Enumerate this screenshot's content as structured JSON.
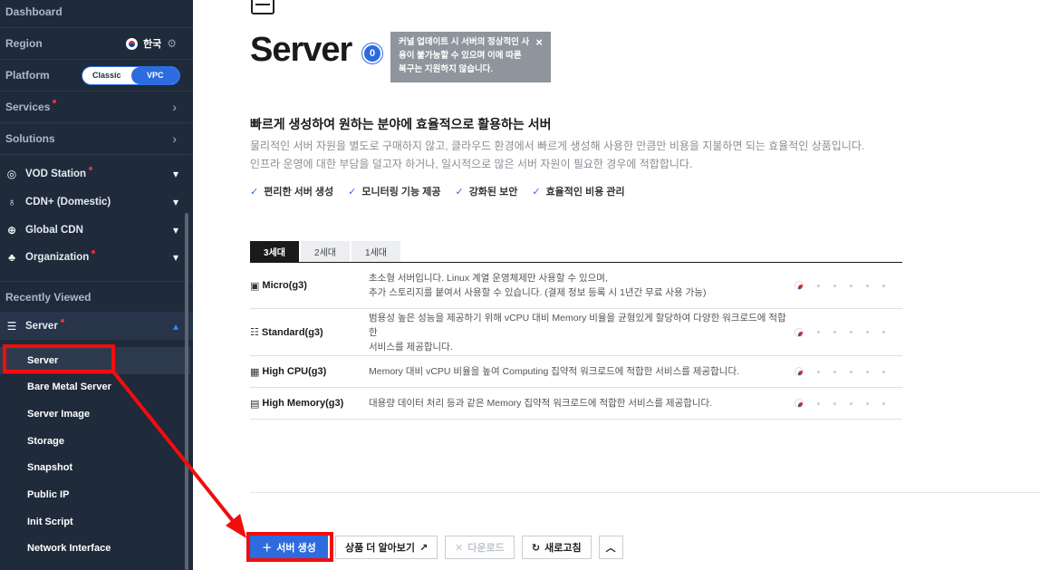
{
  "sidebar": {
    "dashboard": "Dashboard",
    "region_label": "Region",
    "region_value": "한국",
    "platform_label": "Platform",
    "platform_options": [
      "Classic",
      "VPC"
    ],
    "platform_selected": "VPC",
    "services": "Services",
    "solutions": "Solutions",
    "groups": [
      {
        "label": "VOD Station",
        "icon": "vod-icon",
        "new": true
      },
      {
        "label": "CDN+ (Domestic)",
        "icon": "cdn-icon",
        "new": false
      },
      {
        "label": "Global CDN",
        "icon": "globe-icon",
        "new": false
      },
      {
        "label": "Organization",
        "icon": "organization-icon",
        "new": true
      }
    ],
    "recently_viewed": "Recently Viewed",
    "server_group": "Server",
    "sub_items": [
      "Server",
      "Bare Metal Server",
      "Server Image",
      "Storage",
      "Snapshot",
      "Public IP",
      "Init Script",
      "Network Interface"
    ],
    "active_sub_item": "Server"
  },
  "header": {
    "title": "Server",
    "count": "0",
    "tooltip": "커널 업데이트 시 서버의 정상적인 사용이 불가능할 수 있으며 이에 따른 복구는 지원하지 않습니다.",
    "tooltip_close": "×"
  },
  "intro": {
    "heading": "빠르게 생성하여 원하는 분야에 효율적으로 활용하는 서버",
    "desc_line1": "물리적인 서버 자원을 별도로 구매하지 않고, 클라우드 환경에서 빠르게 생성해 사용한 만큼만 비용을 지불하면 되는 효율적인 상품입니다.",
    "desc_line2": "인프라 운영에 대한 부담을 덜고자 하거나, 일시적으로 많은 서버 자원이 필요한 경우에 적합합니다.",
    "features": [
      "편리한 서버 생성",
      "모니터링 기능 제공",
      "강화된 보안",
      "효율적인 비용 관리"
    ]
  },
  "tabs": [
    "3세대",
    "2세대",
    "1세대"
  ],
  "active_tab": "3세대",
  "products": [
    {
      "name": "Micro(g3)",
      "icon": "micro-server-icon",
      "desc1": "초소형 서버입니다. Linux 계열 운영체제만 사용할 수 있으며,",
      "desc2": "추가 스토리지를 붙여서 사용할 수 있습니다. (결제 정보 등록 시 1년간 무료 사용 가능)"
    },
    {
      "name": "Standard(g3)",
      "icon": "standard-server-icon",
      "desc1": "범용성 높은 성능을 제공하기 위해 vCPU 대비 Memory 비율을 균형있게 할당하여 다양한 워크로드에 적합한",
      "desc2": "서비스를 제공합니다."
    },
    {
      "name": "High CPU(g3)",
      "icon": "cpu-server-icon",
      "desc1": "Memory 대비 vCPU 비율을 높여 Computing 집약적 워크로드에 적합한 서비스를 제공합니다.",
      "desc2": ""
    },
    {
      "name": "High Memory(g3)",
      "icon": "memory-server-icon",
      "desc1": "대용량 데이터 처리 등과 같은 Memory 집약적 워크로드에 적합한 서비스를 제공합니다.",
      "desc2": ""
    }
  ],
  "actions": {
    "create": "서버 생성",
    "learn_more": "상품 더 알아보기",
    "download": "다운로드",
    "refresh": "새로고침"
  },
  "colors": {
    "sidebar_bg": "#1f2a3a",
    "accent": "#2d6cdf",
    "highlight": "#f20d0d"
  }
}
